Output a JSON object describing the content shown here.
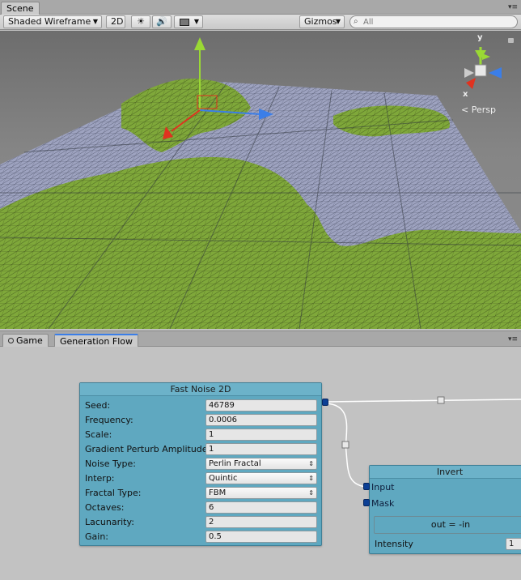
{
  "scene_window": {
    "tab_label": "Scene",
    "panel_menu_glyph": "▾≡",
    "toolbar": {
      "shading_mode": "Shaded Wireframe",
      "two_d_label": "2D",
      "lighting_icon": "sun-icon",
      "audio_icon": "speaker-icon",
      "effects_icon": "image-icon",
      "gizmos_label": "Gizmos",
      "search_placeholder": "All",
      "search_icon": "search-icon"
    },
    "gizmo": {
      "axis_y": "y",
      "axis_x": "x",
      "projection_label": "Persp",
      "lock_icon": "lock-icon",
      "colors": {
        "y": "#9ad934",
        "x": "#e0321f",
        "z": "#3b7ee8"
      }
    },
    "terrain_colors": {
      "land": "#7fa83a",
      "water": "#9ea3c0",
      "wire": "#1f2a0f"
    }
  },
  "bottom_window": {
    "tabs": [
      {
        "label": "Game",
        "icon": "game-controller-icon",
        "active": false
      },
      {
        "label": "Generation Flow",
        "active": true
      }
    ],
    "panel_menu_glyph": "▾≡"
  },
  "graph": {
    "fast_noise_node": {
      "title": "Fast Noise 2D",
      "fields": [
        {
          "label": "Seed:",
          "value": "46789",
          "type": "text"
        },
        {
          "label": "Frequency:",
          "value": "0.0006",
          "type": "text"
        },
        {
          "label": "Scale:",
          "value": "1",
          "type": "text"
        },
        {
          "label": "Gradient Perturb Amplitude:",
          "value": "1",
          "type": "text"
        },
        {
          "label": "Noise Type:",
          "value": "Perlin Fractal",
          "type": "dropdown"
        },
        {
          "label": "Interp:",
          "value": "Quintic",
          "type": "dropdown"
        },
        {
          "label": "Fractal Type:",
          "value": "FBM",
          "type": "dropdown"
        },
        {
          "label": "Octaves:",
          "value": "6",
          "type": "text"
        },
        {
          "label": "Lacunarity:",
          "value": "2",
          "type": "text"
        },
        {
          "label": "Gain:",
          "value": "0.5",
          "type": "text"
        }
      ]
    },
    "invert_node": {
      "title": "Invert",
      "inputs": [
        "Input",
        "Mask"
      ],
      "expression": "out = -in",
      "intensity_label": "Intensity",
      "intensity_value": "1"
    },
    "colors": {
      "node": "#5fa8c0",
      "port": "#0c3f94",
      "wire": "#ffffff"
    }
  }
}
